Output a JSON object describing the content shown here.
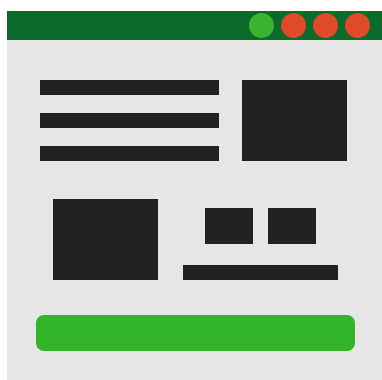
{
  "colors": {
    "titlebar": "#0b6b2c",
    "window_bg": "#e6e6e6",
    "dot_green": "#3bb52f",
    "dot_red": "#e04a2a",
    "block": "#222222",
    "button": "#33b52a"
  },
  "titlebar": {
    "controls": [
      {
        "icon": "green-circle-icon",
        "color": "#3bb52f"
      },
      {
        "icon": "red-circle-icon",
        "color": "#e04a2a"
      },
      {
        "icon": "red-circle-icon",
        "color": "#e04a2a"
      },
      {
        "icon": "red-circle-icon",
        "color": "#e04a2a"
      }
    ]
  },
  "content": {
    "text_lines": 3,
    "image_blocks": 2,
    "small_tiles": 2,
    "caption_bars": 1
  },
  "footer": {
    "button_label": ""
  }
}
